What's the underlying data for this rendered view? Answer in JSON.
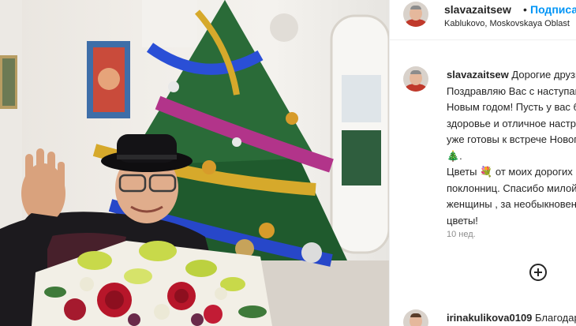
{
  "post": {
    "author": "slavazaitsew",
    "follow_dot": "•",
    "follow_label": "Подписаться",
    "location": "Kablukovo, Moskovskaya Oblast"
  },
  "caption": {
    "username": "slavazaitsew",
    "lines": [
      "Дорогие друзья!",
      "Поздравляю Вас с наступающим",
      "Новым годом! Пусть у вас будет",
      "здоровье и отличное настроение",
      "уже готовы к встрече Нового года",
      "🎄.",
      "Цветы 💐 от моих дорогих",
      "поклонниц. Спасибо милой",
      "женщины , за необыкновенные",
      "цветы!"
    ]
  },
  "time_ago": "10 нед.",
  "comment": {
    "username": "irinakulikova0109",
    "text": "Благодарю"
  },
  "icons": {
    "avatar": "avatar-icon",
    "add": "plus-circle-icon"
  },
  "colors": {
    "link_blue": "#0095f6",
    "text": "#262626",
    "muted": "#8e8e8e"
  }
}
